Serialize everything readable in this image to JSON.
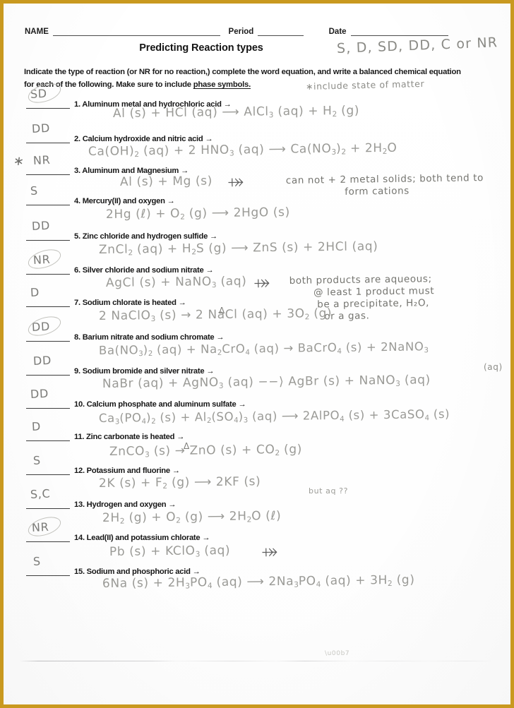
{
  "document": {
    "header": {
      "name_label": "NAME",
      "period_label": "Period",
      "date_label": "Date",
      "title": "Predicting Reaction types",
      "title_annotation": "S, D, SD, DD, C  or NR"
    },
    "instructions": {
      "line1": "Indicate the type of reaction (or NR for no reaction,) complete the word equation, and write a balanced chemical",
      "line2_a": "equation for each of the following. Make sure to include ",
      "line2_underlined": "phase symbols.",
      "annotation": "∗include state of matter"
    },
    "border_color": "#c9991f",
    "handwriting_color": "#8d8d88",
    "print_color": "#1a1a1a"
  },
  "problems": [
    {
      "number": "1.",
      "prompt": "Aluminum metal and hydrochloric acid →",
      "answer": "SD",
      "answer_circled": true,
      "equation_parts": [
        {
          "t": "Al (s)   +   HCl (aq)  ⟶   AlCl"
        },
        {
          "t": "3",
          "sub": true
        },
        {
          "t": " (aq) + H"
        },
        {
          "t": "2",
          "sub": true
        },
        {
          "t": " (g)"
        }
      ]
    },
    {
      "number": "2.",
      "prompt": "Calcium hydroxide and nitric acid →",
      "answer": "DD",
      "answer_circled": false,
      "equation_parts": [
        {
          "t": "Ca(OH)"
        },
        {
          "t": "2",
          "sub": true
        },
        {
          "t": " (aq)  +  2 HNO"
        },
        {
          "t": "3",
          "sub": true
        },
        {
          "t": " (aq)  ⟶  Ca(NO"
        },
        {
          "t": "3",
          "sub": true
        },
        {
          "t": ")"
        },
        {
          "t": "2",
          "sub": true
        },
        {
          "t": " + 2H"
        },
        {
          "t": "2",
          "sub": true
        },
        {
          "t": "O"
        }
      ]
    },
    {
      "number": "3.",
      "prompt": "Aluminum and Magnesium →",
      "answer": "NR",
      "answer_circled": false,
      "margin_mark": "∗",
      "equation_parts": [
        {
          "t": "Al (s)  +  Mg (s)"
        }
      ],
      "crossed_arrow": true,
      "note": "can not + 2 metal solids; both tend to\n                 form cations"
    },
    {
      "number": "4.",
      "prompt": "Mercury(II) and oxygen →",
      "answer": "S",
      "answer_circled": false,
      "equation_parts": [
        {
          "t": "2Hg (ℓ)  +  O"
        },
        {
          "t": "2",
          "sub": true
        },
        {
          "t": " (g) ⟶ 2HgO (s)"
        }
      ]
    },
    {
      "number": "5.",
      "prompt": "Zinc chloride and hydrogen sulfide →",
      "answer": "DD",
      "answer_circled": false,
      "equation_parts": [
        {
          "t": "ZnCl"
        },
        {
          "t": "2",
          "sub": true
        },
        {
          "t": " (aq)  +  H"
        },
        {
          "t": "2",
          "sub": true
        },
        {
          "t": "S (g) ⟶  ZnS (s) + 2HCl (aq)"
        }
      ]
    },
    {
      "number": "6.",
      "prompt": "Silver chloride and sodium nitrate →",
      "answer": "NR",
      "answer_circled": true,
      "equation_parts": [
        {
          "t": "AgCl (s)  +  NaNO"
        },
        {
          "t": "3",
          "sub": true
        },
        {
          "t": " (aq)"
        }
      ],
      "crossed_arrow": true,
      "note": "both products are aqueous;\n       @ least 1 product must\n        be a precipitate, H₂O,\n          or a gas."
    },
    {
      "number": "7.",
      "prompt": "Sodium chlorate is heated →",
      "answer": "D",
      "answer_circled": false,
      "equation_parts": [
        {
          "t": "2 NaClO"
        },
        {
          "t": "3",
          "sub": true
        },
        {
          "t": " (s)  →  2 NaCl (aq) + 3O"
        },
        {
          "t": "2",
          "sub": true
        },
        {
          "t": " (g)"
        }
      ],
      "delta_over_arrow": "Δ"
    },
    {
      "number": "8.",
      "prompt": "Barium nitrate and sodium chromate →",
      "answer": "DD",
      "answer_circled": true,
      "equation_parts": [
        {
          "t": "Ba(NO"
        },
        {
          "t": "3",
          "sub": true
        },
        {
          "t": ")"
        },
        {
          "t": "2",
          "sub": true
        },
        {
          "t": " (aq)  +   Na"
        },
        {
          "t": "2",
          "sub": true
        },
        {
          "t": "CrO"
        },
        {
          "t": "4",
          "sub": true
        },
        {
          "t": "  (aq)   →  BaCrO"
        },
        {
          "t": "4",
          "sub": true
        },
        {
          "t": " (s) + 2NaNO"
        },
        {
          "t": "3",
          "sub": true
        }
      ],
      "trailing": "(aq)"
    },
    {
      "number": "9.",
      "prompt": "Sodium bromide and silver nitrate →",
      "answer": "DD",
      "answer_circled": false,
      "equation_parts": [
        {
          "t": "NaBr (aq) + AgNO"
        },
        {
          "t": "3",
          "sub": true
        },
        {
          "t": " (aq)  −−⟩   AgBr (s) +   NaNO"
        },
        {
          "t": "3",
          "sub": true
        },
        {
          "t": " (aq)"
        }
      ]
    },
    {
      "number": "10.",
      "prompt": "Calcium phosphate and aluminum sulfate →",
      "answer": "DD",
      "answer_circled": false,
      "equation_parts": [
        {
          "t": "Ca"
        },
        {
          "t": "3",
          "sub": true
        },
        {
          "t": "(PO"
        },
        {
          "t": "4",
          "sub": true
        },
        {
          "t": ")"
        },
        {
          "t": "2",
          "sub": true
        },
        {
          "t": " (s) +      Al"
        },
        {
          "t": "2",
          "sub": true
        },
        {
          "t": "(SO"
        },
        {
          "t": "4",
          "sub": true
        },
        {
          "t": ")"
        },
        {
          "t": "3",
          "sub": true
        },
        {
          "t": " (aq) ⟶ 2AlPO"
        },
        {
          "t": "4",
          "sub": true
        },
        {
          "t": " (s) + 3CaSO"
        },
        {
          "t": "4",
          "sub": true
        },
        {
          "t": " (s)"
        }
      ]
    },
    {
      "number": "11.",
      "prompt": "Zinc carbonate is heated →",
      "answer": "D",
      "answer_circled": false,
      "equation_parts": [
        {
          "t": "ZnCO"
        },
        {
          "t": "3",
          "sub": true
        },
        {
          "t": " (s) →  ZnO (s) + CO"
        },
        {
          "t": "2",
          "sub": true
        },
        {
          "t": " (g)"
        }
      ],
      "delta_over_arrow": "Δ"
    },
    {
      "number": "12.",
      "prompt": "Potassium and fluorine →",
      "answer": "S",
      "answer_circled": false,
      "equation_parts": [
        {
          "t": "2K (s)  +  F"
        },
        {
          "t": "2",
          "sub": true
        },
        {
          "t": " (g)  ⟶   2KF (s)"
        }
      ],
      "trailing": "but aq ??"
    },
    {
      "number": "13.",
      "prompt": "Hydrogen and oxygen →",
      "answer": "S,C",
      "answer_circled": false,
      "equation_parts": [
        {
          "t": "2H"
        },
        {
          "t": "2",
          "sub": true
        },
        {
          "t": " (g) + O"
        },
        {
          "t": "2",
          "sub": true
        },
        {
          "t": " (g)  ⟶ 2H"
        },
        {
          "t": "2",
          "sub": true
        },
        {
          "t": "O (ℓ)"
        }
      ]
    },
    {
      "number": "14.",
      "prompt": "Lead(II) and potassium chlorate →",
      "answer": "NR",
      "answer_circled": true,
      "equation_parts": [
        {
          "t": "Pb (s)  +  KClO"
        },
        {
          "t": "3",
          "sub": true
        },
        {
          "t": " (aq)"
        }
      ],
      "crossed_arrow": true
    },
    {
      "number": "15.",
      "prompt": "Sodium and phosphoric acid →",
      "answer": "S",
      "answer_circled": false,
      "equation_parts": [
        {
          "t": "6Na (s)  + 2H"
        },
        {
          "t": "3",
          "sub": true
        },
        {
          "t": "PO"
        },
        {
          "t": "4",
          "sub": true
        },
        {
          "t": " (aq) ⟶ 2Na"
        },
        {
          "t": "3",
          "sub": true
        },
        {
          "t": "PO"
        },
        {
          "t": "4",
          "sub": true
        },
        {
          "t": " (aq) + 3H"
        },
        {
          "t": "2",
          "sub": true
        },
        {
          "t": " (g)"
        }
      ]
    }
  ]
}
